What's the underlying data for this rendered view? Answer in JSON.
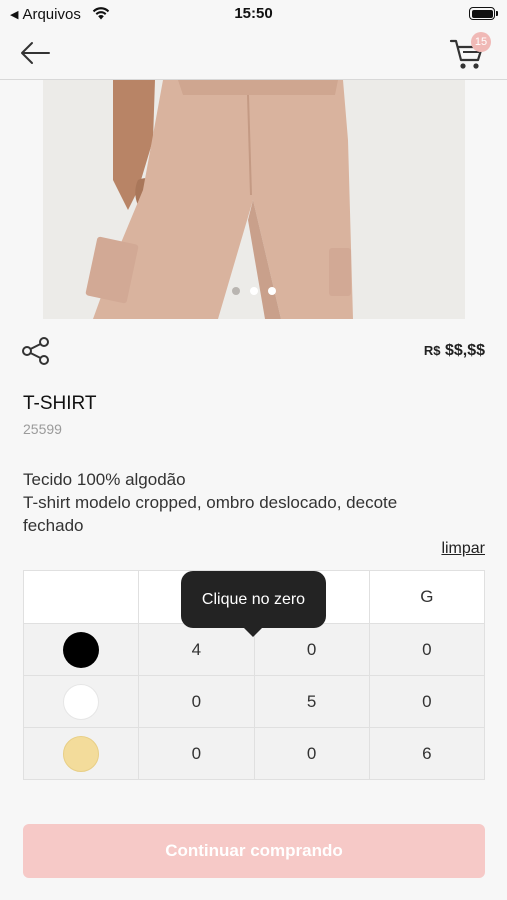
{
  "status_bar": {
    "back_app": "Arquivos",
    "time": "15:50"
  },
  "header": {
    "cart_count": "15"
  },
  "product": {
    "currency": "R$",
    "price": "$$,$$",
    "name": "T-SHIRT",
    "code": "25599",
    "description_lines": [
      "Tecido 100% algodão",
      "T-shirt modelo cropped, ombro deslocado, decote",
      "fechado"
    ],
    "image_dots": {
      "count": 3,
      "active": 0
    }
  },
  "grid": {
    "clear_label": "limpar",
    "sizes": [
      "",
      "",
      "G"
    ],
    "rows": [
      {
        "color": "#000000",
        "values": [
          "4",
          "0",
          "0"
        ]
      },
      {
        "color": "#ffffff",
        "values": [
          "0",
          "5",
          "0"
        ]
      },
      {
        "color": "#f3dc9b",
        "values": [
          "0",
          "0",
          "6"
        ]
      }
    ]
  },
  "tooltip": {
    "text": "Clique no zero"
  },
  "actions": {
    "continue_label": "Continuar comprando"
  },
  "colors": {
    "accent_pink": "#f6c9c7",
    "badge_pink": "#f0b9b6",
    "tooltip_bg": "#232323"
  }
}
